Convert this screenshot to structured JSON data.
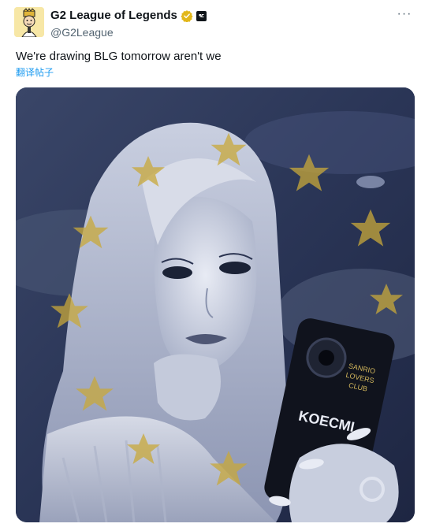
{
  "tweet": {
    "display_name": "G2 League of Legends",
    "handle": "@G2League",
    "text": "We're drawing BLG tomorrow aren't we",
    "translate_label": "翻译帖子",
    "more_label": "···",
    "icons": {
      "verified": "verified-gold-badge-icon",
      "affiliate": "affiliate-org-icon",
      "more": "more-options-icon"
    },
    "media": {
      "kind": "photo",
      "phone_case_text": [
        "SANRIO",
        "LOVERS",
        "CLUB",
        "KOECMI"
      ]
    }
  },
  "colors": {
    "text": "#0f1419",
    "secondary": "#536471",
    "link": "#1d9bf0",
    "verified_gold": "#e2b719",
    "photo_tint": "#2e3a5a",
    "star": "#c9a93a"
  }
}
